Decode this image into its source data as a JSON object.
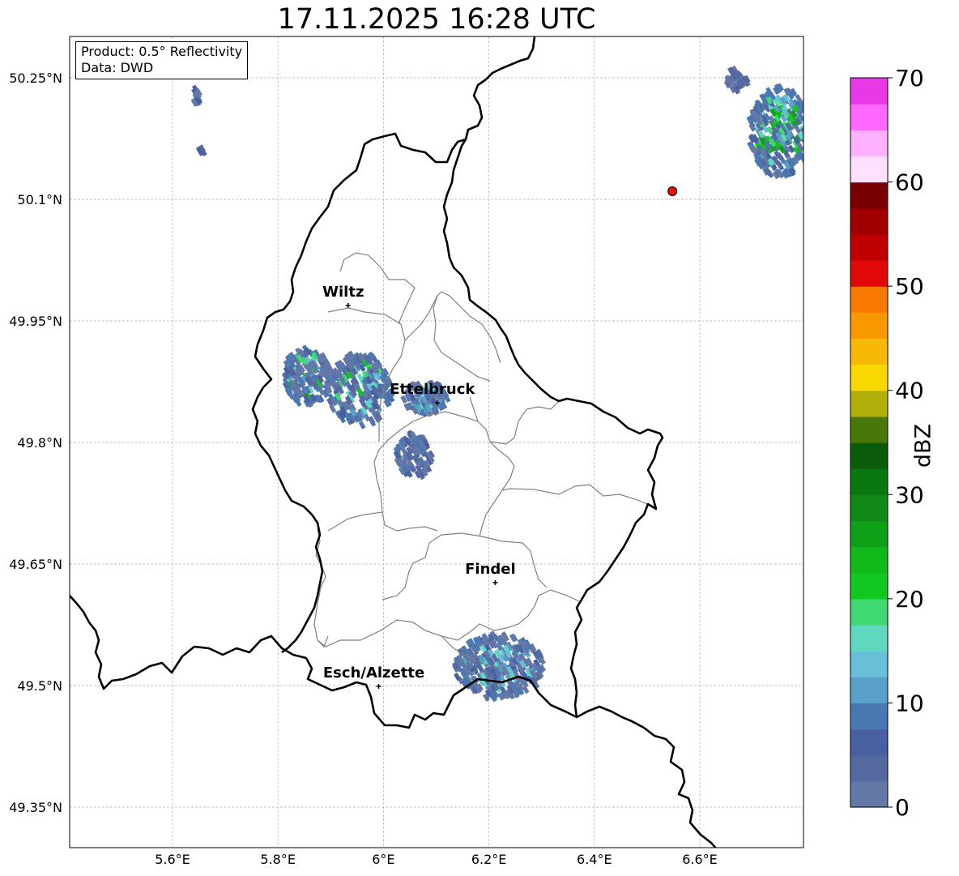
{
  "title": "17.11.2025 16:28 UTC",
  "info": {
    "product": "Product: 0.5° Reflectivity",
    "data_source": "Data: DWD"
  },
  "axes": {
    "lon_ticks": [
      "5.6°E",
      "5.8°E",
      "6°E",
      "6.2°E",
      "6.4°E",
      "6.6°E"
    ],
    "lon_values": [
      5.6,
      5.8,
      6.0,
      6.2,
      6.4,
      6.6
    ],
    "lat_ticks": [
      "50.25°N",
      "50.1°N",
      "49.95°N",
      "49.8°N",
      "49.65°N",
      "49.5°N",
      "49.35°N"
    ],
    "lat_values": [
      50.25,
      50.1,
      49.95,
      49.8,
      49.65,
      49.5,
      49.35
    ],
    "lon_range": [
      5.4,
      6.8
    ],
    "lat_range": [
      49.3,
      50.3
    ],
    "grid": true
  },
  "cities": [
    {
      "name": "Wiltz",
      "lon": 5.933,
      "lat": 49.969
    },
    {
      "name": "Ettelbruck",
      "lon": 6.102,
      "lat": 49.849
    },
    {
      "name": "Findel",
      "lon": 6.212,
      "lat": 49.627
    },
    {
      "name": "Esch/Alzette",
      "lon": 5.991,
      "lat": 49.499
    }
  ],
  "radar_site": {
    "lon": 6.548,
    "lat": 50.11,
    "color": "#e8100c"
  },
  "colorbar": {
    "label": "dBZ",
    "ticks": [
      "0",
      "10",
      "20",
      "30",
      "40",
      "50",
      "60",
      "70"
    ],
    "min": 0,
    "max": 70,
    "step": 2.5,
    "colors": [
      "#6478a8",
      "#5668a0",
      "#4860a0",
      "#4a78b0",
      "#58a0c8",
      "#68c0d8",
      "#60d8c0",
      "#40d870",
      "#10c820",
      "#10b818",
      "#10a018",
      "#108818",
      "#0a7810",
      "#0a5c0a",
      "#4a7808",
      "#b0b008",
      "#f8d800",
      "#f8b808",
      "#f89800",
      "#f87800",
      "#e00808",
      "#c00000",
      "#a00000",
      "#780000",
      "#ffe0ff",
      "#ffb0ff",
      "#ff68ff",
      "#e838e8"
    ]
  }
}
